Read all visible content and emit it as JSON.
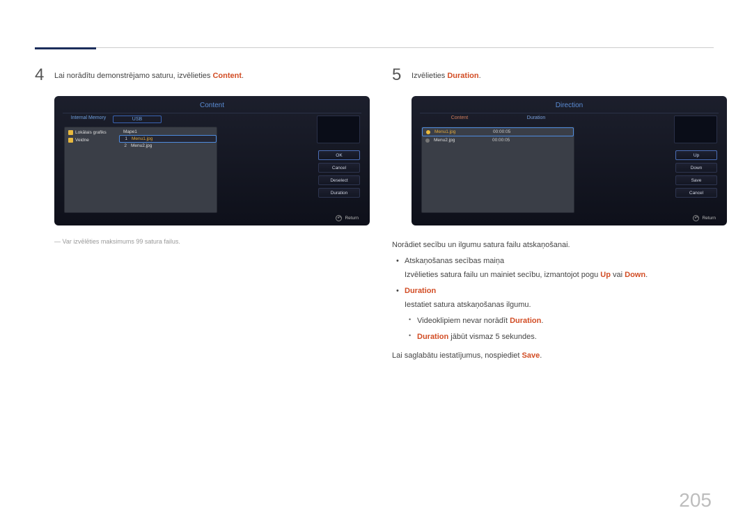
{
  "page_number": "205",
  "left": {
    "step_num": "4",
    "step_text_a": "Lai norādītu demonstrējamo saturu, izvēlieties ",
    "step_text_hl": "Content",
    "step_text_b": ".",
    "footnote": "Var izvēlēties maksimums 99 satura failus.",
    "screen": {
      "title": "Content",
      "tab1": "Internal Memory",
      "tab2": "USB",
      "folder1": "Lokālais grafiks",
      "folder2": "Veidne",
      "rrow_header": "Mape1",
      "rrow1_idx": "1",
      "rrow1": "Menu1.jpg",
      "rrow2_idx": "2",
      "rrow2": "Menu2.jpg",
      "btn_ok": "OK",
      "btn_cancel": "Cancel",
      "btn_deselect": "Deselect",
      "btn_duration": "Duration",
      "return": "Return"
    }
  },
  "right": {
    "step_num": "5",
    "step_text_a": "Izvēlieties ",
    "step_text_hl": "Duration",
    "step_text_b": ".",
    "screen": {
      "title": "Direction",
      "col1": "Content",
      "col2": "Duration",
      "row1_name": "Menu1.jpg",
      "row1_dur": "00:00:05",
      "row2_name": "Menu2.jpg",
      "row2_dur": "00:00:05",
      "btn_up": "Up",
      "btn_down": "Down",
      "btn_save": "Save",
      "btn_cancel": "Cancel",
      "return": "Return"
    },
    "desc": {
      "p1": "Norādiet secību un ilgumu satura failu atskaņošanai.",
      "li1_title": "Atskaņošanas secības maiņa",
      "li1_line_a": "Izvēlieties satura failu un mainiet secību, izmantojot pogu ",
      "li1_hl1": "Up",
      "li1_mid": " vai ",
      "li1_hl2": "Down",
      "li1_end": ".",
      "li2_title": "Duration",
      "li2_line": "Iestatiet satura atskaņošanas ilgumu.",
      "li2_s1_a": "Videoklipiem nevar norādīt ",
      "li2_s1_hl": "Duration",
      "li2_s1_b": ".",
      "li2_s2_hl": "Duration",
      "li2_s2_b": " jābūt vismaz 5 sekundes.",
      "p2_a": "Lai saglabātu iestatījumus, nospiediet ",
      "p2_hl": "Save",
      "p2_b": "."
    }
  }
}
